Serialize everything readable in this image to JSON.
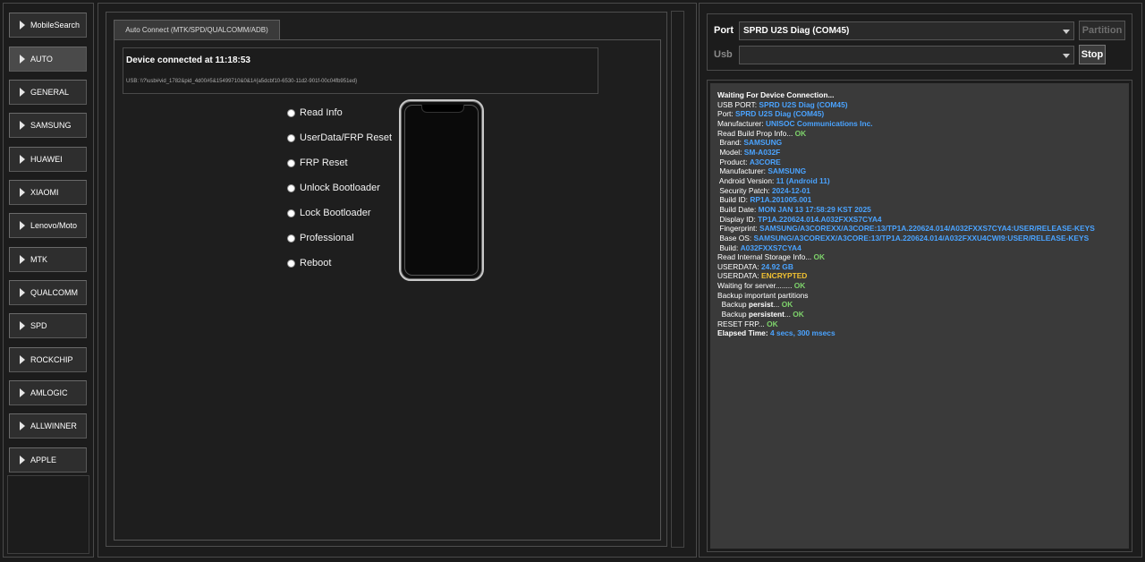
{
  "sidebar": {
    "items": [
      {
        "label": "MobileSearch",
        "active": false
      },
      {
        "label": "AUTO",
        "active": true
      },
      {
        "label": "GENERAL",
        "active": false
      },
      {
        "label": "SAMSUNG",
        "active": false
      },
      {
        "label": "HUAWEI",
        "active": false
      },
      {
        "label": "XIAOMI",
        "active": false
      },
      {
        "label": "Lenovo/Moto",
        "active": false
      },
      {
        "label": "MTK",
        "active": false
      },
      {
        "label": "QUALCOMM",
        "active": false
      },
      {
        "label": "SPD",
        "active": false
      },
      {
        "label": "ROCKCHIP",
        "active": false
      },
      {
        "label": "AMLOGIC",
        "active": false
      },
      {
        "label": "ALLWINNER",
        "active": false
      },
      {
        "label": "APPLE",
        "active": false
      }
    ]
  },
  "main": {
    "tab_label": "Auto Connect (MTK/SPD/QUALCOMM/ADB)",
    "device_connected": "Device connected at 11:18:53",
    "usb_path": "USB: \\\\?\\usb#vid_1782&pid_4d00#5&15499710&0&1#{a5dcbf10-6530-11d2-901f-00c04fb951ed}",
    "options": [
      "Read Info",
      "UserData/FRP Reset",
      "FRP Reset",
      "Unlock Bootloader",
      "Lock Bootloader",
      "Professional",
      "Reboot"
    ]
  },
  "connection": {
    "port_label": "Port",
    "port_value": "SPRD U2S Diag (COM45)",
    "usb_label": "Usb",
    "usb_value": "",
    "partition_button": "Partition",
    "stop_button": "Stop"
  },
  "log": {
    "lines": [
      [
        {
          "t": "Waiting For Device Connection...",
          "c": "b"
        }
      ],
      [
        {
          "t": "USB PORT: ",
          "c": "k"
        },
        {
          "t": "SPRD U2S Diag (COM45)",
          "c": "v"
        }
      ],
      [
        {
          "t": "Port: ",
          "c": "k"
        },
        {
          "t": "SPRD U2S Diag (COM45)",
          "c": "v"
        }
      ],
      [
        {
          "t": "Manufacturer: ",
          "c": "k"
        },
        {
          "t": "UNISOC Communications Inc.",
          "c": "v"
        }
      ],
      [
        {
          "t": "Read Build Prop Info... ",
          "c": "k"
        },
        {
          "t": "OK",
          "c": "ok"
        }
      ],
      [
        {
          "t": " Brand: ",
          "c": "k"
        },
        {
          "t": "SAMSUNG",
          "c": "v"
        }
      ],
      [
        {
          "t": " Model: ",
          "c": "k"
        },
        {
          "t": "SM-A032F",
          "c": "v"
        }
      ],
      [
        {
          "t": " Product: ",
          "c": "k"
        },
        {
          "t": "A3CORE",
          "c": "v"
        }
      ],
      [
        {
          "t": " Manufacturer: ",
          "c": "k"
        },
        {
          "t": "SAMSUNG",
          "c": "v"
        }
      ],
      [
        {
          "t": " Android Version: ",
          "c": "k"
        },
        {
          "t": "11 (Android 11)",
          "c": "v"
        }
      ],
      [
        {
          "t": " Security Patch: ",
          "c": "k"
        },
        {
          "t": "2024-12-01",
          "c": "v"
        }
      ],
      [
        {
          "t": " Build ID: ",
          "c": "k"
        },
        {
          "t": "RP1A.201005.001",
          "c": "v"
        }
      ],
      [
        {
          "t": " Build Date: ",
          "c": "k"
        },
        {
          "t": "MON JAN 13 17:58:29 KST 2025",
          "c": "v"
        }
      ],
      [
        {
          "t": " Display ID: ",
          "c": "k"
        },
        {
          "t": "TP1A.220624.014.A032FXXS7CYA4",
          "c": "v"
        }
      ],
      [
        {
          "t": " Fingerprint: ",
          "c": "k"
        },
        {
          "t": "SAMSUNG/A3COREXX/A3CORE:13/TP1A.220624.014/A032FXXS7CYA4:USER/RELEASE-KEYS",
          "c": "v"
        }
      ],
      [
        {
          "t": " Base OS: ",
          "c": "k"
        },
        {
          "t": "SAMSUNG/A3COREXX/A3CORE:13/TP1A.220624.014/A032FXXU4CWI9:USER/RELEASE-KEYS",
          "c": "v"
        }
      ],
      [
        {
          "t": " Build: ",
          "c": "k"
        },
        {
          "t": "A032FXXS7CYA4",
          "c": "v"
        }
      ],
      [
        {
          "t": "Read Internal Storage Info... ",
          "c": "k"
        },
        {
          "t": "OK",
          "c": "ok"
        }
      ],
      [
        {
          "t": "USERDATA: ",
          "c": "k"
        },
        {
          "t": "24.92 GB",
          "c": "v"
        }
      ],
      [
        {
          "t": "USERDATA: ",
          "c": "k"
        },
        {
          "t": "ENCRYPTED",
          "c": "warn"
        }
      ],
      [
        {
          "t": "Waiting for server........ ",
          "c": "k"
        },
        {
          "t": "OK",
          "c": "ok"
        }
      ],
      [
        {
          "t": "Backup important partitions",
          "c": "k"
        }
      ],
      [
        {
          "t": "  Backup ",
          "c": "k"
        },
        {
          "t": "persist",
          "c": "b"
        },
        {
          "t": "... ",
          "c": "k"
        },
        {
          "t": "OK",
          "c": "ok"
        }
      ],
      [
        {
          "t": "  Backup ",
          "c": "k"
        },
        {
          "t": "persistent",
          "c": "b"
        },
        {
          "t": "... ",
          "c": "k"
        },
        {
          "t": "OK",
          "c": "ok"
        }
      ],
      [
        {
          "t": "RESET FRP... ",
          "c": "k"
        },
        {
          "t": "OK",
          "c": "ok"
        }
      ],
      [
        {
          "t": "Elapsed Time: ",
          "c": "b"
        },
        {
          "t": "4 secs, 300 msecs",
          "c": "v"
        }
      ]
    ]
  },
  "colors": {
    "background": "#1b1b1b",
    "log_background": "#3a3a3a",
    "value_blue": "#4aa3ff",
    "ok_green": "#7ed36b",
    "warning_yellow": "#f2c231"
  }
}
